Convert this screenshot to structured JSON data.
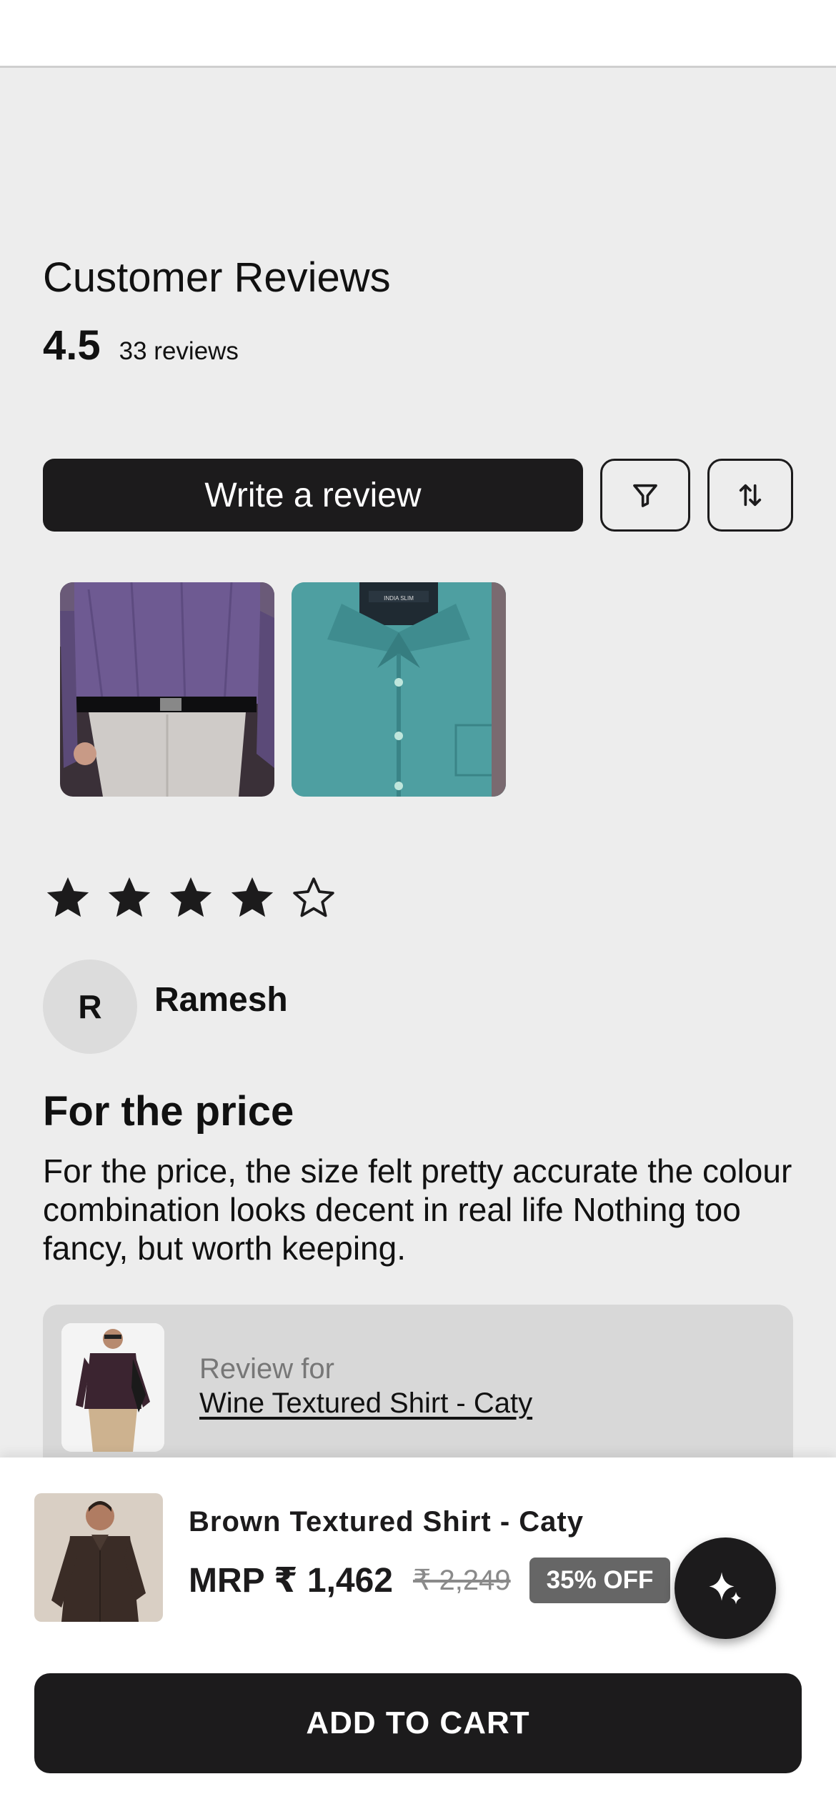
{
  "reviews_summary": {
    "title": "Customer Reviews",
    "rating": "4.5",
    "count_text": "33 reviews"
  },
  "actions": {
    "write_review_label": "Write a review",
    "filter_icon": "filter-icon",
    "sort_icon": "sort-arrows-icon"
  },
  "review_photos": [
    {
      "alt": "purple-shirt-photo"
    },
    {
      "alt": "teal-shirt-photo"
    }
  ],
  "review": {
    "rating": 4,
    "max_rating": 5,
    "reviewer_initial": "R",
    "reviewer_name": "Ramesh",
    "title": "For the price",
    "body": "For the price, the size felt pretty accurate the colour combination looks decent in real life Nothing too fancy, but worth keeping.",
    "review_for_label": "Review for",
    "review_for_product": "Wine Textured Shirt - Caty"
  },
  "product_bar": {
    "name": "Brown Textured Shirt - Caty",
    "price": "MRP ₹ 1,462",
    "original_price": "₹ 2,249",
    "discount": "35% OFF",
    "fab_icon": "sparkle-icon",
    "add_to_cart_label": "ADD TO CART"
  },
  "colors": {
    "primary": "#1c1b1c",
    "background": "#ededed",
    "badge": "#666666"
  }
}
